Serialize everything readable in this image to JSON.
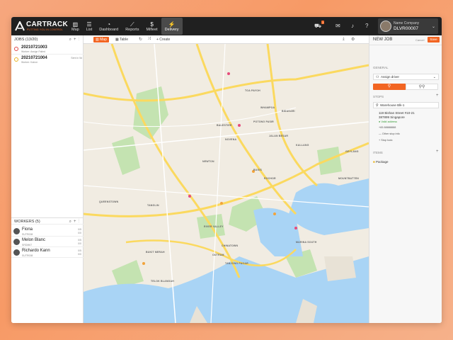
{
  "brand": {
    "name": "CARTRACK",
    "tagline": "PUTTING YOU IN CONTROL"
  },
  "nav": [
    {
      "label": "Map",
      "icon": "map-icon"
    },
    {
      "label": "List",
      "icon": "list-icon"
    },
    {
      "label": "Dashboard",
      "icon": "dashboard-icon"
    },
    {
      "label": "Reports",
      "icon": "reports-icon"
    },
    {
      "label": "Mifleet",
      "icon": "dollar-icon"
    },
    {
      "label": "Delivery",
      "icon": "bolt-icon"
    }
  ],
  "topright": {
    "notification_count": "1",
    "company": "Name Company",
    "user_id": "DLVR00007"
  },
  "jobs": {
    "header": "JOBS (13/20)",
    "items": [
      {
        "id": "20210721003",
        "sub": "Worker: Assign Failed",
        "sent": "",
        "color": "#e04a4a"
      },
      {
        "id": "20210721004",
        "sub": "Worker: Kairon",
        "sent": "Sent in 5d",
        "color": "#e8b320"
      }
    ]
  },
  "workers": {
    "header": "WORKERS (5)",
    "items": [
      {
        "name": "Fiona",
        "sub": "SUTR008",
        "r1": "0/5",
        "r2": "0/0"
      },
      {
        "name": "Melon Blanc",
        "sub": "SRDM67",
        "r1": "0/5",
        "r2": "0/0"
      },
      {
        "name": "Richardo Kann",
        "sub": "SUTR008",
        "r1": "0/5",
        "r2": "0/0"
      }
    ]
  },
  "map_toolbar": {
    "map": "Map",
    "table": "Table",
    "create": "+ Create"
  },
  "map_labels": [
    "TOA PAYOH",
    "BIDADARI",
    "POTONG PASIR",
    "BALESTIER",
    "NOVENA",
    "NEWTON",
    "KALLANG",
    "BUGIS",
    "TANGLIN",
    "QUEENSTOWN",
    "RIVER VALLEY",
    "BUKIT MERAH",
    "OUTRAM",
    "TANJONG PAGAR",
    "MARINA SOUTH",
    "TELOK BLANGAH",
    "GEYLANG",
    "MOUNTBATTEN",
    "JALAN BESAR",
    "ROCHOR",
    "CHINATOWN",
    "WHAMPOA"
  ],
  "new_job": {
    "title": "NEW JOB",
    "cancel": "Cancel",
    "save": "Save",
    "general": "GENERAL",
    "driver": "Assign driver",
    "stops": "STOPS",
    "stop_name": "Warehouse Blk-1",
    "address1": "119 Bishan Street #10-21",
    "address2": "387899 Singapore",
    "valid": "Valid address",
    "phone": "+65 88888888",
    "other_info": "Other stop info",
    "stop_todo": "Stop todo",
    "items": "ITEMS",
    "package": "Package"
  },
  "colors": {
    "accent": "#f26522",
    "topbar": "#202020",
    "water": "#a9d4f5",
    "park": "#c4e3b1",
    "road": "#fbd95f"
  }
}
